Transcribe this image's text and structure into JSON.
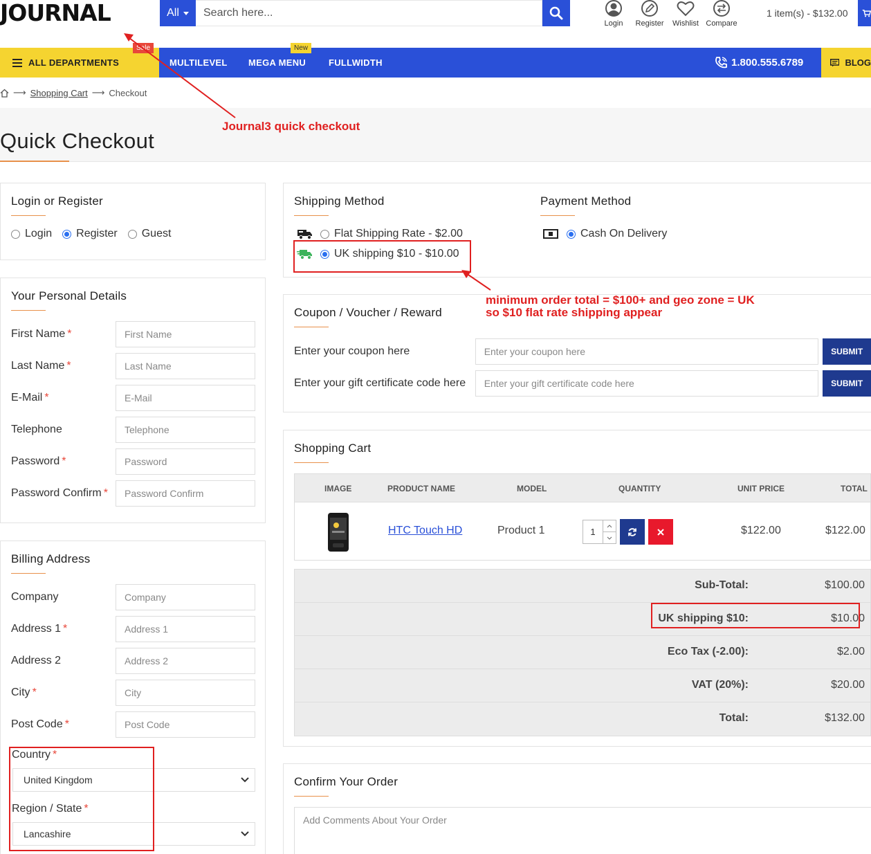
{
  "header": {
    "logo_text": "JOURNAL",
    "search_category": "All",
    "search_placeholder": "Search here...",
    "icons": [
      {
        "label": "Login",
        "icon": "user-icon"
      },
      {
        "label": "Register",
        "icon": "pencil-icon"
      },
      {
        "label": "Wishlist",
        "icon": "heart-icon"
      },
      {
        "label": "Compare",
        "icon": "compare-icon"
      }
    ],
    "cart_summary": "1 item(s) - $132.00"
  },
  "nav": {
    "departments": "ALL DEPARTMENTS",
    "items": [
      "MULTILEVEL",
      "MEGA MENU",
      "FULLWIDTH"
    ],
    "badge_sale": "Sale",
    "badge_new": "New",
    "phone": "1.800.555.6789",
    "blog": "BLOG"
  },
  "breadcrumb": {
    "items": [
      "Shopping Cart",
      "Checkout"
    ]
  },
  "page": {
    "title": "Quick Checkout"
  },
  "login": {
    "title": "Login or Register",
    "options": [
      {
        "label": "Login",
        "checked": false
      },
      {
        "label": "Register",
        "checked": true
      },
      {
        "label": "Guest",
        "checked": false
      }
    ]
  },
  "personal": {
    "title": "Your Personal Details",
    "fields": [
      {
        "label": "First Name",
        "required": true,
        "placeholder": "First Name"
      },
      {
        "label": "Last Name",
        "required": true,
        "placeholder": "Last Name"
      },
      {
        "label": "E-Mail",
        "required": true,
        "placeholder": "E-Mail"
      },
      {
        "label": "Telephone",
        "required": false,
        "placeholder": "Telephone"
      },
      {
        "label": "Password",
        "required": true,
        "placeholder": "Password"
      },
      {
        "label": "Password Confirm",
        "required": true,
        "placeholder": "Password Confirm"
      }
    ]
  },
  "billing": {
    "title": "Billing Address",
    "fields": [
      {
        "label": "Company",
        "required": false,
        "placeholder": "Company"
      },
      {
        "label": "Address 1",
        "required": true,
        "placeholder": "Address 1"
      },
      {
        "label": "Address 2",
        "required": false,
        "placeholder": "Address 2"
      },
      {
        "label": "City",
        "required": true,
        "placeholder": "City"
      },
      {
        "label": "Post Code",
        "required": true,
        "placeholder": "Post Code"
      }
    ],
    "country_label": "Country",
    "country_value": "United Kingdom",
    "region_label": "Region / State",
    "region_value": "Lancashire"
  },
  "shipping": {
    "title": "Shipping Method",
    "options": [
      {
        "label": "Flat Shipping Rate - $2.00",
        "checked": false
      },
      {
        "label": "UK shipping $10 - $10.00",
        "checked": true
      }
    ]
  },
  "payment": {
    "title": "Payment Method",
    "options": [
      {
        "label": "Cash On Delivery",
        "checked": true
      }
    ]
  },
  "coupon": {
    "title": "Coupon / Voucher / Reward",
    "rows": [
      {
        "label": "Enter your coupon here",
        "placeholder": "Enter your coupon here",
        "button": "SUBMIT"
      },
      {
        "label": "Enter your gift certificate code here",
        "placeholder": "Enter your gift certificate code here",
        "button": "SUBMIT"
      }
    ]
  },
  "cart": {
    "title": "Shopping Cart",
    "columns": [
      "IMAGE",
      "PRODUCT NAME",
      "MODEL",
      "QUANTITY",
      "UNIT PRICE",
      "TOTAL"
    ],
    "items": [
      {
        "name": "HTC Touch HD",
        "model": "Product 1",
        "quantity": "1",
        "unit_price": "$122.00",
        "total": "$122.00"
      }
    ],
    "totals": [
      {
        "label": "Sub-Total:",
        "value": "$100.00"
      },
      {
        "label": "UK shipping $10:",
        "value": "$10.00"
      },
      {
        "label": "Eco Tax (-2.00):",
        "value": "$2.00"
      },
      {
        "label": "VAT (20%):",
        "value": "$20.00"
      },
      {
        "label": "Total:",
        "value": "$132.00"
      }
    ]
  },
  "confirm": {
    "title": "Confirm Your Order",
    "comments_placeholder": "Add Comments About Your Order"
  },
  "annotations": {
    "logo_note": "Journal3 quick checkout",
    "shipping_note_line1": "minimum order total = $100+ and geo zone = UK",
    "shipping_note_line2": "so $10 flat rate shipping appear",
    "color": "#e02020"
  },
  "colors": {
    "primary_blue": "#2a50d8",
    "accent_yellow": "#f5d430",
    "sale_red": "#e8473a",
    "submit_navy": "#1f3a8f",
    "remove_red": "#e8192c"
  }
}
